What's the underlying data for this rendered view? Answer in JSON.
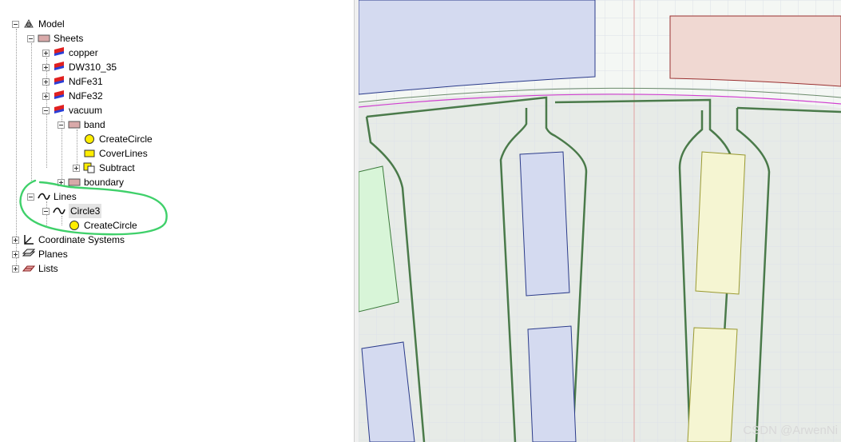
{
  "tree": {
    "model": "Model",
    "sheets": "Sheets",
    "materials": [
      "copper",
      "DW310_35",
      "NdFe31",
      "NdFe32",
      "vacuum"
    ],
    "band": "band",
    "band_children": [
      "CreateCircle",
      "CoverLines",
      "Subtract"
    ],
    "boundary": "boundary",
    "lines": "Lines",
    "circle3": "Circle3",
    "circle3_child": "CreateCircle",
    "coordinate_systems": "Coordinate Systems",
    "planes": "Planes",
    "lists": "Lists"
  },
  "watermark": "CSDN @ArwenNi",
  "colors": {
    "annotation_green": "#3fd06a",
    "blue_region": "#d4daf0",
    "red_region": "#f0d8d2",
    "green_region": "#d8f5d8",
    "yellow_region": "#f5f5d2",
    "slot_outline": "#4a7a4a",
    "magenta_arc": "#d040d0"
  },
  "icons": {
    "model": "model-icon",
    "sheets": "sheet-folder-icon",
    "material": "material-sheet-icon",
    "operation": "create-circle-icon",
    "cover": "cover-lines-icon",
    "subtract": "subtract-icon",
    "lines": "line-icon",
    "coordinate": "coordinate-system-icon",
    "planes": "planes-icon",
    "lists": "lists-icon"
  }
}
